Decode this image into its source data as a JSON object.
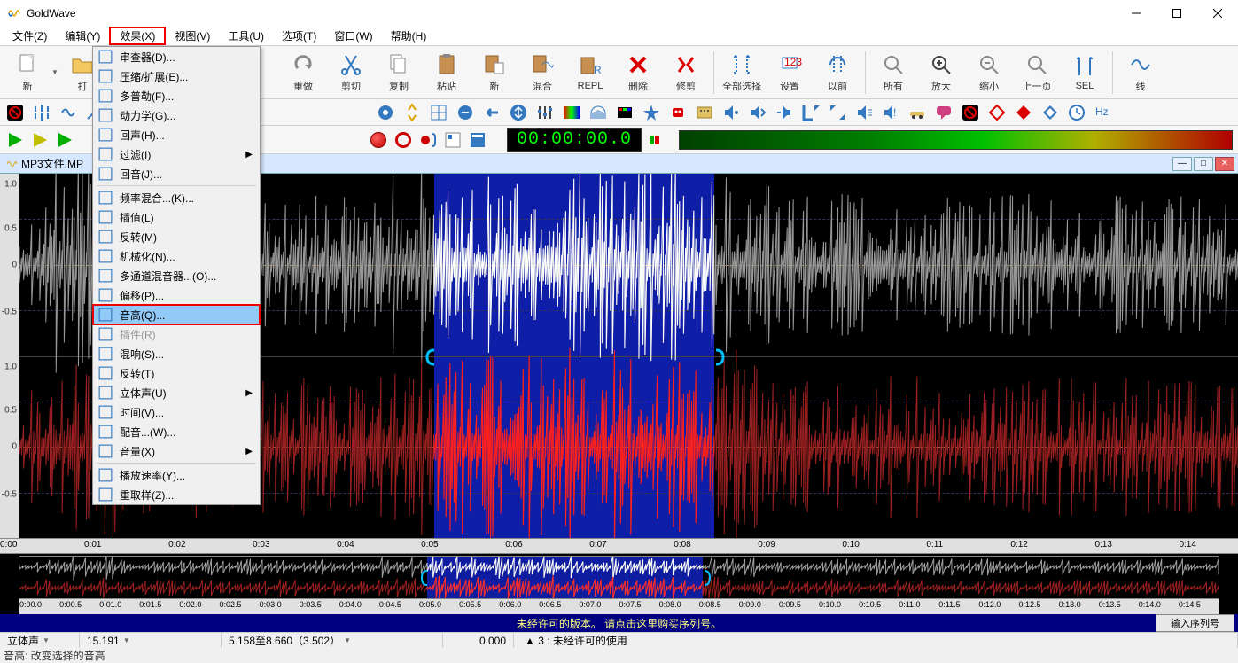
{
  "app": {
    "title": "GoldWave"
  },
  "menubar": {
    "items": [
      "文件(Z)",
      "编辑(Y)",
      "效果(X)",
      "视图(V)",
      "工具(U)",
      "选项(T)",
      "窗口(W)",
      "帮助(H)"
    ],
    "highlighted_index": 2
  },
  "toolbar1": {
    "buttons": [
      {
        "label": "新",
        "name": "new"
      },
      {
        "label": "打",
        "name": "open"
      },
      {
        "label": "重做",
        "name": "redo",
        "after_spacer": true
      },
      {
        "label": "剪切",
        "name": "cut"
      },
      {
        "label": "复制",
        "name": "copy"
      },
      {
        "label": "粘贴",
        "name": "paste"
      },
      {
        "label": "新",
        "name": "paste-new"
      },
      {
        "label": "混合",
        "name": "mix"
      },
      {
        "label": "REPL",
        "name": "replace"
      },
      {
        "label": "删除",
        "name": "delete"
      },
      {
        "label": "修剪",
        "name": "trim"
      },
      {
        "label": "全部选择",
        "name": "select-all",
        "sep_before": true
      },
      {
        "label": "设置",
        "name": "set-sel"
      },
      {
        "label": "以前",
        "name": "previous"
      },
      {
        "label": "所有",
        "name": "view-all",
        "sep_before": true
      },
      {
        "label": "放大",
        "name": "zoom-in"
      },
      {
        "label": "缩小",
        "name": "zoom-out"
      },
      {
        "label": "上一页",
        "name": "prev-page"
      },
      {
        "label": "SEL",
        "name": "zoom-sel"
      },
      {
        "label": "线",
        "name": "line",
        "sep_before": true
      }
    ]
  },
  "dropdown": {
    "items": [
      {
        "label": "审查器(D)...",
        "name": "censor"
      },
      {
        "label": "压缩/扩展(E)...",
        "name": "compressor"
      },
      {
        "label": "多普勒(F)...",
        "name": "doppler"
      },
      {
        "label": "动力学(G)...",
        "name": "dynamics"
      },
      {
        "label": "回声(H)...",
        "name": "echo"
      },
      {
        "label": "过滤(I)",
        "name": "filter",
        "arrow": true
      },
      {
        "label": "回音(J)...",
        "name": "flanger"
      },
      {
        "sep": true
      },
      {
        "label": "频率混合...(K)...",
        "name": "freq-blend"
      },
      {
        "label": "插值(L)",
        "name": "interpolate"
      },
      {
        "label": "反转(M)",
        "name": "invert"
      },
      {
        "label": "机械化(N)...",
        "name": "mechanize"
      },
      {
        "label": "多通道混音器...(O)...",
        "name": "multichannel"
      },
      {
        "label": "偏移(P)...",
        "name": "offset"
      },
      {
        "label": "音高(Q)...",
        "name": "pitch",
        "highlighted": true
      },
      {
        "label": "插件(R)",
        "name": "plugin",
        "disabled": true
      },
      {
        "label": "混响(S)...",
        "name": "reverb"
      },
      {
        "label": "反转(T)",
        "name": "reverse"
      },
      {
        "label": "立体声(U)",
        "name": "stereo",
        "arrow": true
      },
      {
        "label": "时间(V)...",
        "name": "time"
      },
      {
        "label": "配音...(W)...",
        "name": "voiceover"
      },
      {
        "label": "音量(X)",
        "name": "volume",
        "arrow": true
      },
      {
        "sep": true
      },
      {
        "label": "播放速率(Y)...",
        "name": "playback-rate"
      },
      {
        "label": "重取样(Z)...",
        "name": "resample"
      }
    ]
  },
  "file_tab": {
    "label": "MP3文件.MP"
  },
  "time_display": "00:00:00.0",
  "waveform": {
    "left_scale": [
      "1.0",
      "0.5",
      "0",
      "-0.5",
      "1.0",
      "0.5",
      "0",
      "-0.5"
    ],
    "time_ruler": [
      "0:00",
      "0:01",
      "0:02",
      "0:03",
      "0:04",
      "0:05",
      "0:06",
      "0:07",
      "0:08",
      "0:09",
      "0:10",
      "0:11",
      "0:12",
      "0:13",
      "0:14"
    ],
    "overview_ruler": [
      "0:00.0",
      "0:00.5",
      "0:01.0",
      "0:01.5",
      "0:02.0",
      "0:02.5",
      "0:03.0",
      "0:03.5",
      "0:04.0",
      "0:04.5",
      "0:05.0",
      "0:05.5",
      "0:06.0",
      "0:06.5",
      "0:07.0",
      "0:07.5",
      "0:08.0",
      "0:08.5",
      "0:09.0",
      "0:09.5",
      "0:10.0",
      "0:10.5",
      "0:11.0",
      "0:11.5",
      "0:12.0",
      "0:12.5",
      "0:13.0",
      "0:13.5",
      "0:14.0",
      "0:14.5"
    ],
    "selection": {
      "start_pct": 34,
      "end_pct": 57
    }
  },
  "purchase_bar": {
    "text": "未经许可的版本。 请点击这里购买序列号。",
    "button": "输入序列号"
  },
  "statusbar": {
    "channels": "立体声",
    "length": "15.191",
    "selection": "5.158至8.660（3.502）",
    "pos": "0.000",
    "extra": "3 :  未经许可的使用"
  },
  "hint": "音高: 改变选择的音高"
}
